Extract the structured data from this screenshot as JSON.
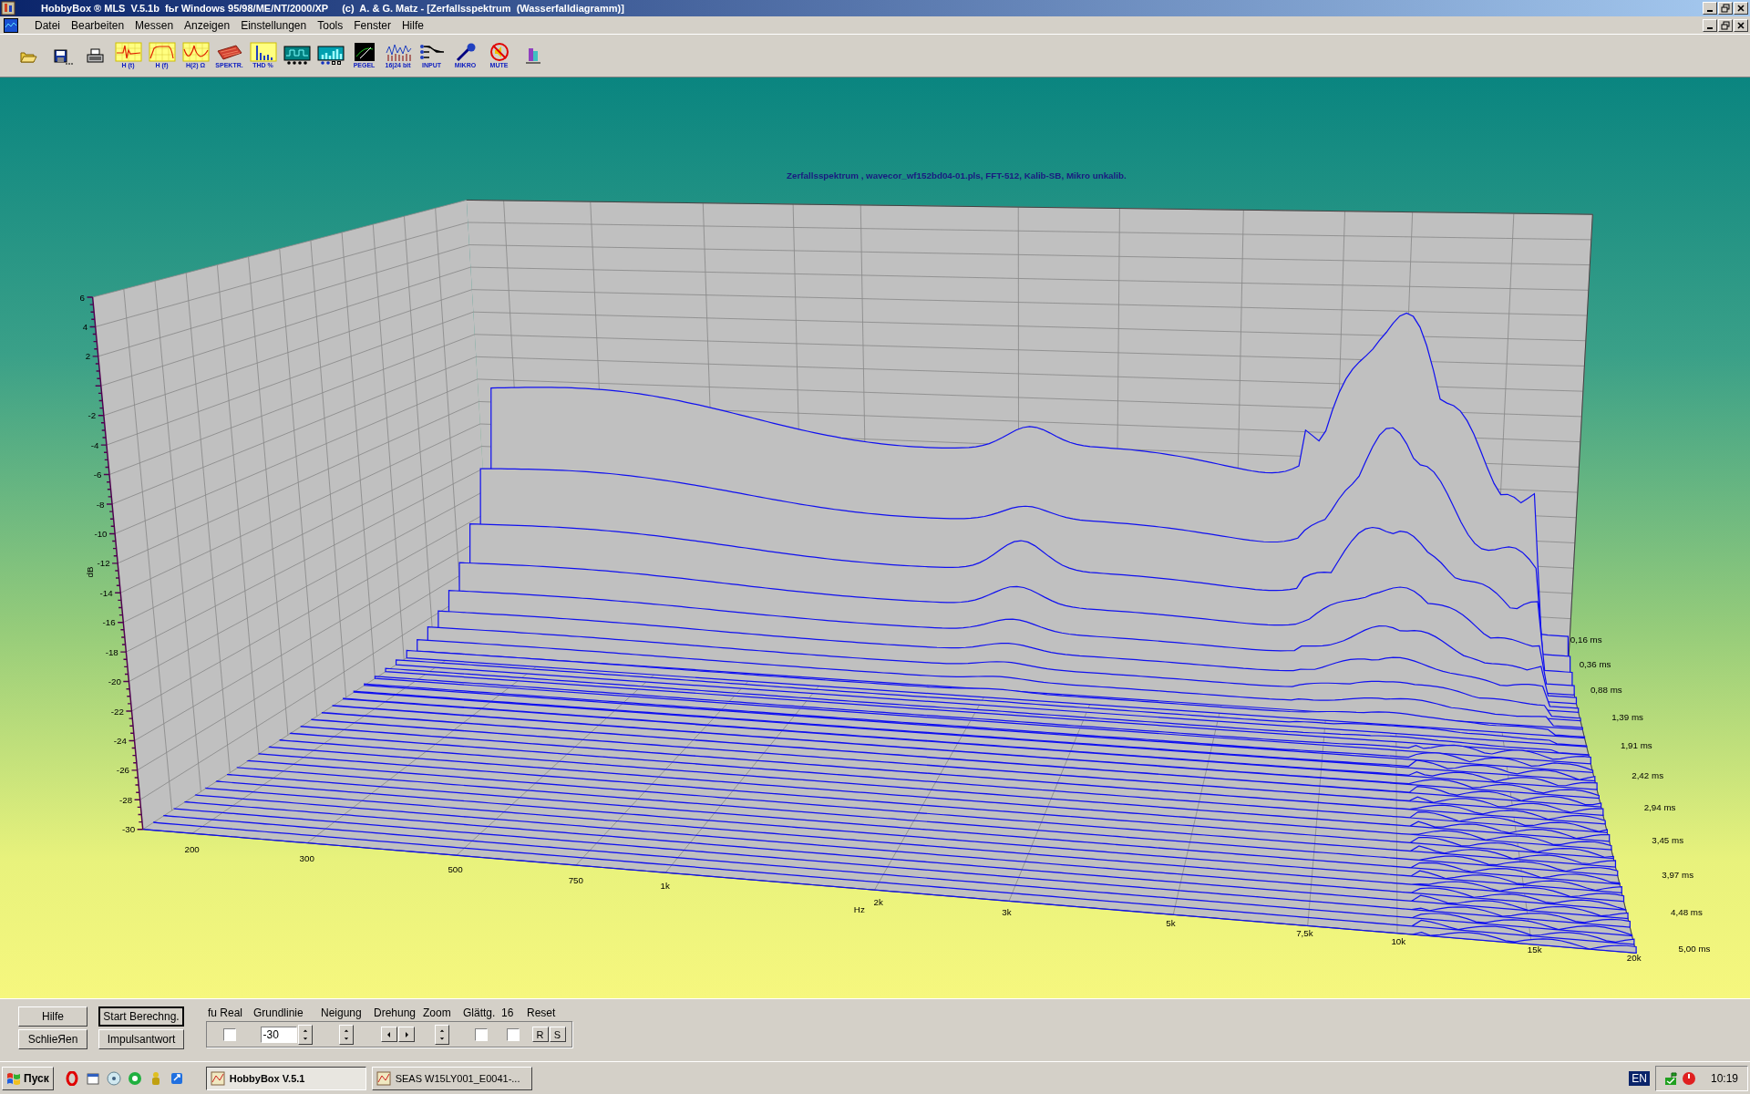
{
  "window": {
    "title": "HobbyBox ® MLS  V.5.1b  fьr Windows 95/98/ME/NT/2000/XP     (c)  A. & G. Matz - [Zerfallsspektrum  (Wasserfalldiagramm)]"
  },
  "menu": [
    "Datei",
    "Bearbeiten",
    "Messen",
    "Anzeigen",
    "Einstellungen",
    "Tools",
    "Fenster",
    "Hilfe"
  ],
  "toolbar": [
    {
      "kind": "open"
    },
    {
      "kind": "save"
    },
    {
      "kind": "print"
    },
    {
      "kind": "ht",
      "label": "H (t)"
    },
    {
      "kind": "hf",
      "label": "H (f)"
    },
    {
      "kind": "h2",
      "label": "H(2) Ω"
    },
    {
      "kind": "spektr",
      "label": "SPEKTR."
    },
    {
      "kind": "thd",
      "label": "THD %"
    },
    {
      "kind": "scope"
    },
    {
      "kind": "bars"
    },
    {
      "kind": "pegel",
      "label": "PEGEL"
    },
    {
      "kind": "bits",
      "label": "16|24 bit"
    },
    {
      "kind": "input",
      "label": "INPUT"
    },
    {
      "kind": "mikro",
      "label": "MIKRO"
    },
    {
      "kind": "mute",
      "label": "MUTE"
    },
    {
      "kind": "plug"
    }
  ],
  "chart": {
    "title": "Zerfallsspektrum , wavecor_wf152bd04-01.pls, FFT-512, Kalib-SB, Mikro unkalib.",
    "y_label": "dB",
    "y_ticks": [
      "6",
      "4",
      "2",
      "-2",
      "-4",
      "-6",
      "-8",
      "-10",
      "-12",
      "-14",
      "-16",
      "-18",
      "-20",
      "-22",
      "-24",
      "-26",
      "-28",
      "-30"
    ],
    "x_label": "Hz",
    "x_ticks": [
      "200",
      "300",
      "500",
      "750",
      "1k",
      "2k",
      "3k",
      "5k",
      "7,5k",
      "10k",
      "15k",
      "20k"
    ],
    "z_ticks": [
      "0,16 ms",
      "0,36 ms",
      "0,88 ms",
      "1,39 ms",
      "1,91 ms",
      "2,42 ms",
      "2,94 ms",
      "3,45 ms",
      "3,97 ms",
      "4,48 ms",
      "5,00 ms"
    ]
  },
  "controls": {
    "buttons": [
      {
        "label": "Hilfe",
        "default": false
      },
      {
        "label": "Start Berechng.",
        "default": true
      },
      {
        "label": "SchlieЯen",
        "default": false
      },
      {
        "label": "Impulsantwort",
        "default": false
      }
    ],
    "fields": [
      {
        "label": "fu Real",
        "kind": "checkbox",
        "checked": false
      },
      {
        "label": "Grundlinie",
        "kind": "number",
        "value": "-30"
      },
      {
        "label": "Neigung",
        "kind": "spin"
      },
      {
        "label": "Drehung",
        "kind": "arrows"
      },
      {
        "label": "Zoom",
        "kind": "spin"
      },
      {
        "label": "Glättg.",
        "kind": "checkbox",
        "checked": false
      },
      {
        "label": "16",
        "kind": "checkbox",
        "checked": false
      },
      {
        "label": "Reset",
        "kind": "reset",
        "buttons": [
          "R",
          "S"
        ]
      }
    ]
  },
  "taskbar": {
    "start": "Пуск",
    "quick_launch": [
      {
        "kind": "opera"
      },
      {
        "kind": "calendar"
      },
      {
        "kind": "disc"
      },
      {
        "kind": "chat"
      },
      {
        "kind": "figure"
      },
      {
        "kind": "arrow"
      }
    ],
    "tasks": [
      {
        "label": "HobbyBox V.5.1",
        "selected": true
      },
      {
        "label": "SEAS W15LY001_E0041-...",
        "selected": false
      }
    ],
    "language": "EN",
    "clock": "10:19"
  }
}
